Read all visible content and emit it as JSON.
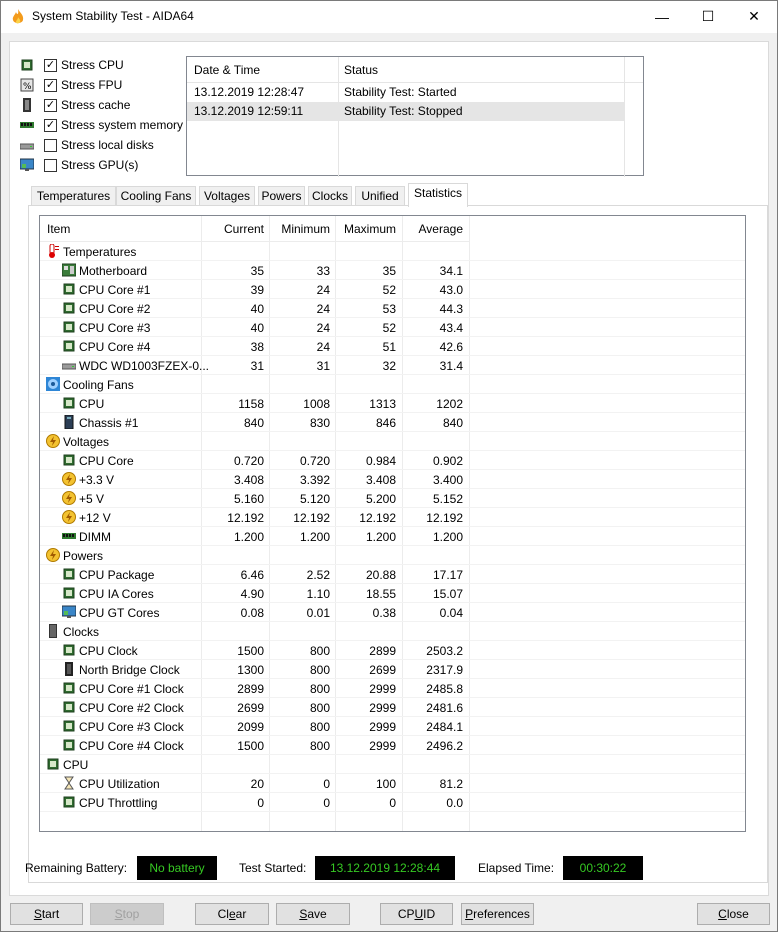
{
  "window": {
    "title": "System Stability Test - AIDA64",
    "minimize": "—",
    "maximize": "☐",
    "close": "✕"
  },
  "options": [
    {
      "label": "Stress CPU",
      "checked": true,
      "icon": "cpu-chip-icon"
    },
    {
      "label": "Stress FPU",
      "checked": true,
      "icon": "fpu-chip-icon"
    },
    {
      "label": "Stress cache",
      "checked": true,
      "icon": "cache-chip-icon"
    },
    {
      "label": "Stress system memory",
      "checked": true,
      "icon": "memory-module-icon"
    },
    {
      "label": "Stress local disks",
      "checked": false,
      "icon": "hard-disk-icon"
    },
    {
      "label": "Stress GPU(s)",
      "checked": false,
      "icon": "monitor-icon"
    }
  ],
  "log": {
    "headers": {
      "datetime": "Date & Time",
      "status": "Status"
    },
    "rows": [
      {
        "datetime": "13.12.2019 12:28:47",
        "status": "Stability Test: Started"
      },
      {
        "datetime": "13.12.2019 12:59:11",
        "status": "Stability Test: Stopped"
      }
    ]
  },
  "tabs": [
    "Temperatures",
    "Cooling Fans",
    "Voltages",
    "Powers",
    "Clocks",
    "Unified",
    "Statistics"
  ],
  "active_tab": "Statistics",
  "stats": {
    "headers": {
      "item": "Item",
      "current": "Current",
      "minimum": "Minimum",
      "maximum": "Maximum",
      "average": "Average"
    },
    "rows": [
      {
        "group": true,
        "label": "Temperatures",
        "icon": "thermometer-icon"
      },
      {
        "label": "Motherboard",
        "icon": "motherboard-icon",
        "current": "35",
        "minimum": "33",
        "maximum": "35",
        "average": "34.1"
      },
      {
        "label": "CPU Core #1",
        "icon": "cpu-chip-icon",
        "current": "39",
        "minimum": "24",
        "maximum": "52",
        "average": "43.0"
      },
      {
        "label": "CPU Core #2",
        "icon": "cpu-chip-icon",
        "current": "40",
        "minimum": "24",
        "maximum": "53",
        "average": "44.3"
      },
      {
        "label": "CPU Core #3",
        "icon": "cpu-chip-icon",
        "current": "40",
        "minimum": "24",
        "maximum": "52",
        "average": "43.4"
      },
      {
        "label": "CPU Core #4",
        "icon": "cpu-chip-icon",
        "current": "38",
        "minimum": "24",
        "maximum": "51",
        "average": "42.6"
      },
      {
        "label": "WDC WD1003FZEX-0...",
        "icon": "hard-disk-icon",
        "current": "31",
        "minimum": "31",
        "maximum": "32",
        "average": "31.4"
      },
      {
        "group": true,
        "label": "Cooling Fans",
        "icon": "fan-icon"
      },
      {
        "label": "CPU",
        "icon": "cpu-chip-icon",
        "current": "1158",
        "minimum": "1008",
        "maximum": "1313",
        "average": "1202"
      },
      {
        "label": "Chassis #1",
        "icon": "chassis-icon",
        "current": "840",
        "minimum": "830",
        "maximum": "846",
        "average": "840"
      },
      {
        "group": true,
        "label": "Voltages",
        "icon": "lightning-icon"
      },
      {
        "label": "CPU Core",
        "icon": "cpu-chip-icon",
        "current": "0.720",
        "minimum": "0.720",
        "maximum": "0.984",
        "average": "0.902"
      },
      {
        "label": "+3.3 V",
        "icon": "lightning-icon",
        "current": "3.408",
        "minimum": "3.392",
        "maximum": "3.408",
        "average": "3.400"
      },
      {
        "label": "+5 V",
        "icon": "lightning-icon",
        "current": "5.160",
        "minimum": "5.120",
        "maximum": "5.200",
        "average": "5.152"
      },
      {
        "label": "+12 V",
        "icon": "lightning-icon",
        "current": "12.192",
        "minimum": "12.192",
        "maximum": "12.192",
        "average": "12.192"
      },
      {
        "label": "DIMM",
        "icon": "memory-module-icon",
        "current": "1.200",
        "minimum": "1.200",
        "maximum": "1.200",
        "average": "1.200"
      },
      {
        "group": true,
        "label": "Powers",
        "icon": "lightning-icon"
      },
      {
        "label": "CPU Package",
        "icon": "cpu-chip-icon",
        "current": "6.46",
        "minimum": "2.52",
        "maximum": "20.88",
        "average": "17.17"
      },
      {
        "label": "CPU IA Cores",
        "icon": "cpu-chip-icon",
        "current": "4.90",
        "minimum": "1.10",
        "maximum": "18.55",
        "average": "15.07"
      },
      {
        "label": "CPU GT Cores",
        "icon": "monitor-icon",
        "current": "0.08",
        "minimum": "0.01",
        "maximum": "0.38",
        "average": "0.04"
      },
      {
        "group": true,
        "label": "Clocks",
        "icon": "clock-chip-icon"
      },
      {
        "label": "CPU Clock",
        "icon": "cpu-chip-icon",
        "current": "1500",
        "minimum": "800",
        "maximum": "2899",
        "average": "2503.2"
      },
      {
        "label": "North Bridge Clock",
        "icon": "chip-dark-icon",
        "current": "1300",
        "minimum": "800",
        "maximum": "2699",
        "average": "2317.9"
      },
      {
        "label": "CPU Core #1 Clock",
        "icon": "cpu-chip-icon",
        "current": "2899",
        "minimum": "800",
        "maximum": "2999",
        "average": "2485.8"
      },
      {
        "label": "CPU Core #2 Clock",
        "icon": "cpu-chip-icon",
        "current": "2699",
        "minimum": "800",
        "maximum": "2999",
        "average": "2481.6"
      },
      {
        "label": "CPU Core #3 Clock",
        "icon": "cpu-chip-icon",
        "current": "2099",
        "minimum": "800",
        "maximum": "2999",
        "average": "2484.1"
      },
      {
        "label": "CPU Core #4 Clock",
        "icon": "cpu-chip-icon",
        "current": "1500",
        "minimum": "800",
        "maximum": "2999",
        "average": "2496.2"
      },
      {
        "group": true,
        "label": "CPU",
        "icon": "cpu-chip-icon"
      },
      {
        "label": "CPU Utilization",
        "icon": "hourglass-icon",
        "current": "20",
        "minimum": "0",
        "maximum": "100",
        "average": "81.2"
      },
      {
        "label": "CPU Throttling",
        "icon": "cpu-chip-icon",
        "current": "0",
        "minimum": "0",
        "maximum": "0",
        "average": "0.0"
      }
    ]
  },
  "status": {
    "battery_label": "Remaining Battery:",
    "battery_value": "No battery",
    "started_label": "Test Started:",
    "started_value": "13.12.2019 12:28:44",
    "elapsed_label": "Elapsed Time:",
    "elapsed_value": "00:30:22"
  },
  "buttons": {
    "start": {
      "pre": "",
      "ul": "S",
      "post": "tart"
    },
    "stop": {
      "pre": "",
      "ul": "S",
      "post": "top"
    },
    "clear": {
      "pre": "Cl",
      "ul": "e",
      "post": "ar"
    },
    "save": {
      "pre": "",
      "ul": "S",
      "post": "ave"
    },
    "cpuid": {
      "pre": "CP",
      "ul": "U",
      "post": "ID"
    },
    "preferences": {
      "pre": "",
      "ul": "P",
      "post": "references"
    },
    "close": {
      "pre": "",
      "ul": "C",
      "post": "lose"
    }
  },
  "colors": {
    "lcd_bg": "#000000",
    "lcd_text": "#36c923",
    "selected_row": "#e5e5e5"
  }
}
